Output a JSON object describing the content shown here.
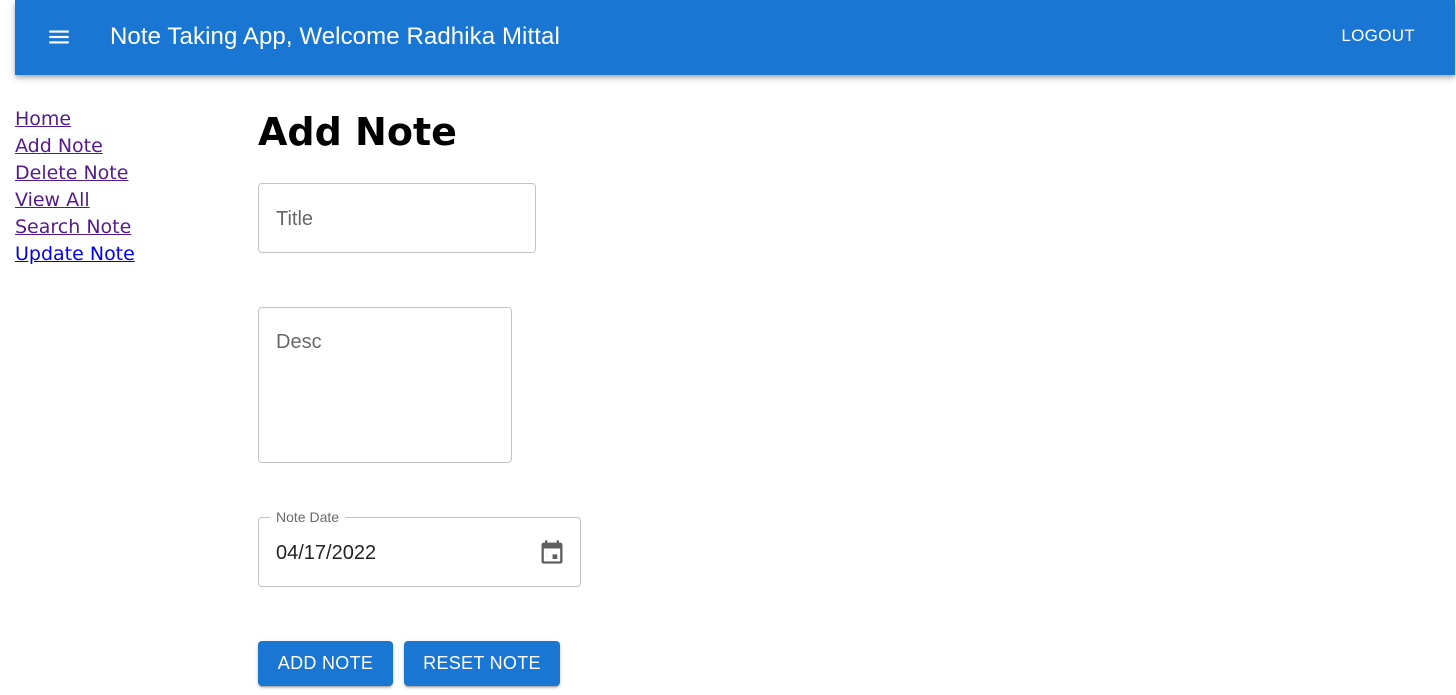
{
  "appbar": {
    "menu_icon": "menu-icon",
    "title": "Note Taking App, Welcome Radhika Mittal",
    "logout_label": "LOGOUT",
    "background_color": "#1976d2"
  },
  "sidebar": {
    "items": [
      {
        "label": "Home"
      },
      {
        "label": "Add Note"
      },
      {
        "label": "Delete Note"
      },
      {
        "label": "View All"
      },
      {
        "label": "Search Note"
      },
      {
        "label": "Update Note"
      }
    ]
  },
  "main": {
    "heading": "Add Note",
    "title_field": {
      "placeholder": "Title",
      "value": ""
    },
    "desc_field": {
      "placeholder": "Desc",
      "value": ""
    },
    "date_field": {
      "label": "Note Date",
      "value": "04/17/2022",
      "icon": "calendar-icon"
    },
    "add_button_label": "ADD NOTE",
    "reset_button_label": "RESET NOTE",
    "button_color": "#1976d2"
  }
}
